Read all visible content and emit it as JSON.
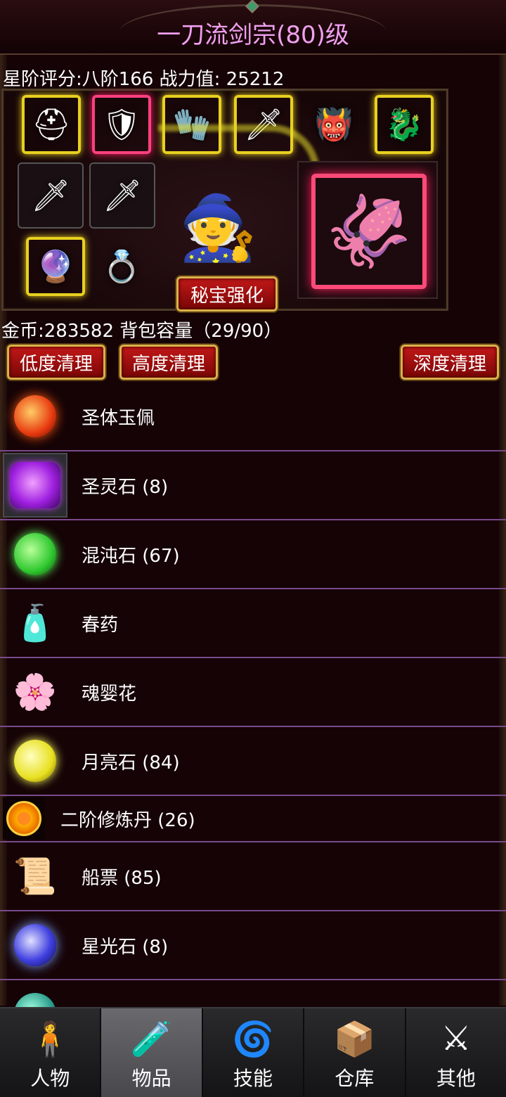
{
  "header": {
    "title": "一刀流剑宗(80)级"
  },
  "stats": {
    "line": "星阶评分:八阶166 战力值:  25212"
  },
  "equipment": {
    "slots": [
      {
        "icon": "helmet-icon",
        "glyph": "⛑"
      },
      {
        "icon": "armor-icon",
        "glyph": "🛡"
      },
      {
        "icon": "gauntlet-icon",
        "glyph": "🧤"
      },
      {
        "icon": "blade-icon",
        "glyph": "🗡"
      },
      {
        "icon": "guardian-icon",
        "glyph": "👹"
      },
      {
        "icon": "beast-mask-icon",
        "glyph": "🐉"
      },
      {
        "icon": "red-sword-icon",
        "glyph": "🗡"
      },
      {
        "icon": "red-sword-icon",
        "glyph": "🗡"
      },
      {
        "icon": "orb-ring-icon",
        "glyph": "🔮"
      },
      {
        "icon": "crown-ring-icon",
        "glyph": "💍"
      }
    ],
    "hero_glyph": "🧙",
    "pet_glyph": "🦑",
    "secret_button": "秘宝强化"
  },
  "inventory": {
    "summary": "金币:283582 背包容量（29/90）",
    "buttons": {
      "low": "低度清理",
      "high": "高度清理",
      "deep": "深度清理"
    },
    "items": [
      {
        "name": "圣体玉佩"
      },
      {
        "name": "圣灵石 (8)"
      },
      {
        "name": "混沌石 (67)"
      },
      {
        "name": "春药"
      },
      {
        "name": "魂婴花"
      },
      {
        "name": "月亮石 (84)"
      },
      {
        "name": "二阶修炼丹 (26)"
      },
      {
        "name": "船票 (85)"
      },
      {
        "name": "星光石 (8)"
      }
    ]
  },
  "nav": {
    "tabs": [
      {
        "label": "人物",
        "glyph": "🧍"
      },
      {
        "label": "物品",
        "glyph": "🧪"
      },
      {
        "label": "技能",
        "glyph": "🌀"
      },
      {
        "label": "仓库",
        "glyph": "📦"
      },
      {
        "label": "其他",
        "glyph": "⚔"
      }
    ]
  },
  "colors": {
    "accent": "#f0a0f0",
    "divider": "#7a4a8a",
    "button": "#c21818"
  }
}
